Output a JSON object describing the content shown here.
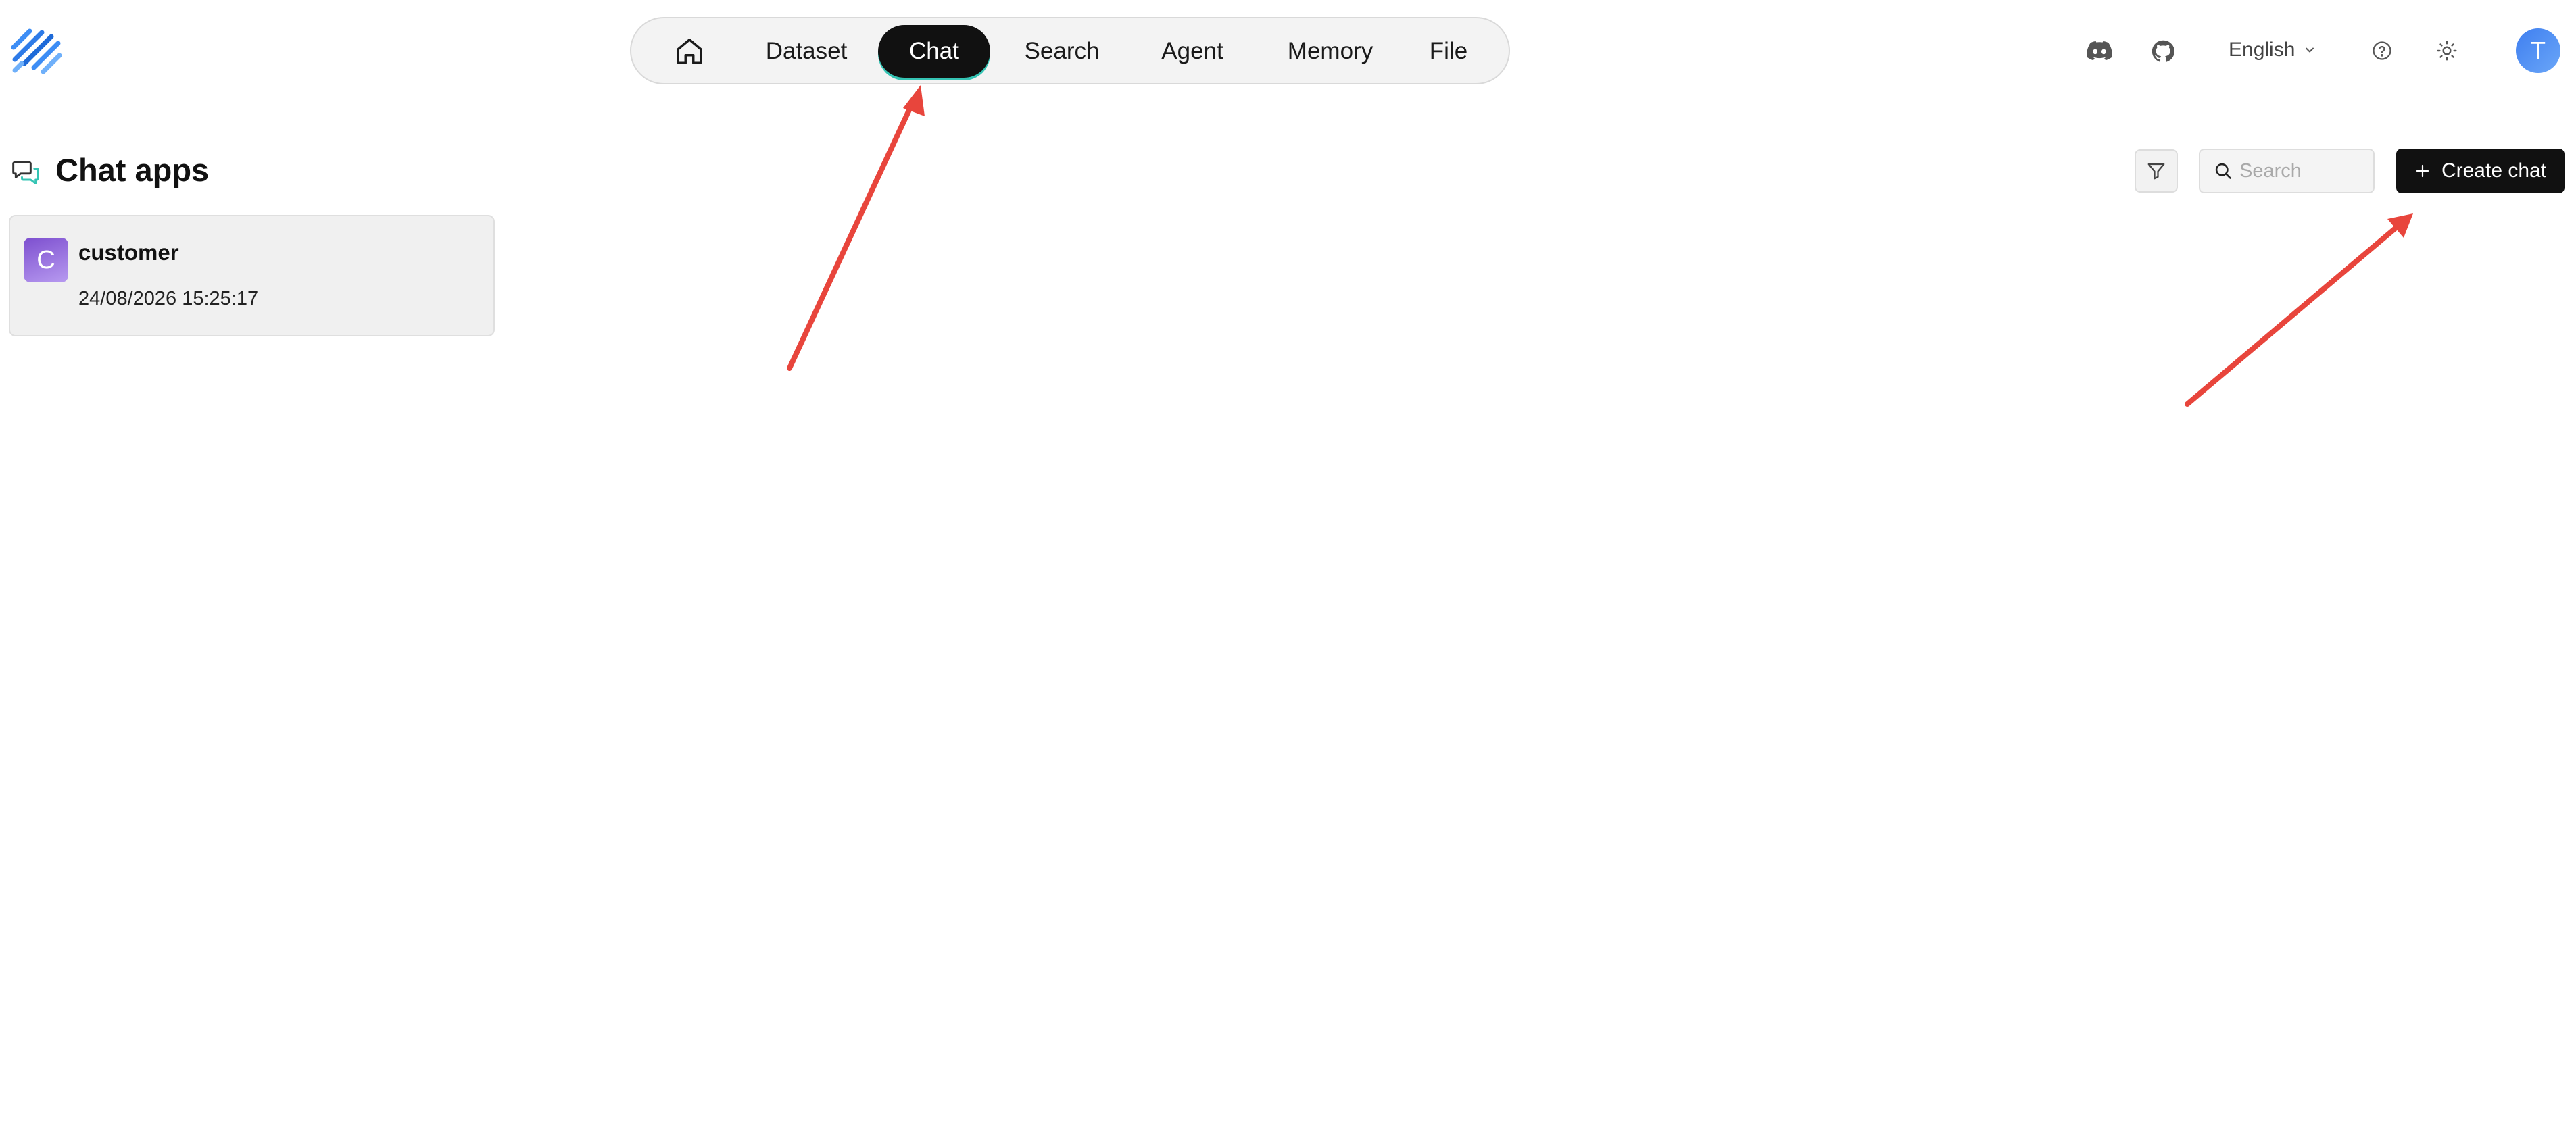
{
  "header": {
    "logo_icon": "ragflow-logo-icon",
    "nav": {
      "home_icon": "home-icon",
      "items": [
        "Dataset",
        "Chat",
        "Search",
        "Agent",
        "Memory",
        "File"
      ],
      "active": "Chat"
    },
    "discord_icon": "discord-icon",
    "github_icon": "github-icon",
    "language": "English",
    "help_icon": "help-circle-icon",
    "theme_icon": "sun-icon",
    "user_initial": "T"
  },
  "main": {
    "title": "Chat apps",
    "title_icon": "chat-bubbles-icon",
    "filter_icon": "filter-icon",
    "search": {
      "placeholder": "Search",
      "value": ""
    },
    "create_button": {
      "icon": "plus-icon",
      "label": "Create chat"
    },
    "cards": [
      {
        "initial": "C",
        "name": "customer",
        "date": "24/08/2026 15:25:17"
      }
    ]
  },
  "colors": {
    "accent_dark": "#111111",
    "active_underline": "#35c4b4",
    "annotation_arrow": "#e8453c",
    "user_avatar": "#4a8af4",
    "card_avatar": "#8e63d8"
  }
}
